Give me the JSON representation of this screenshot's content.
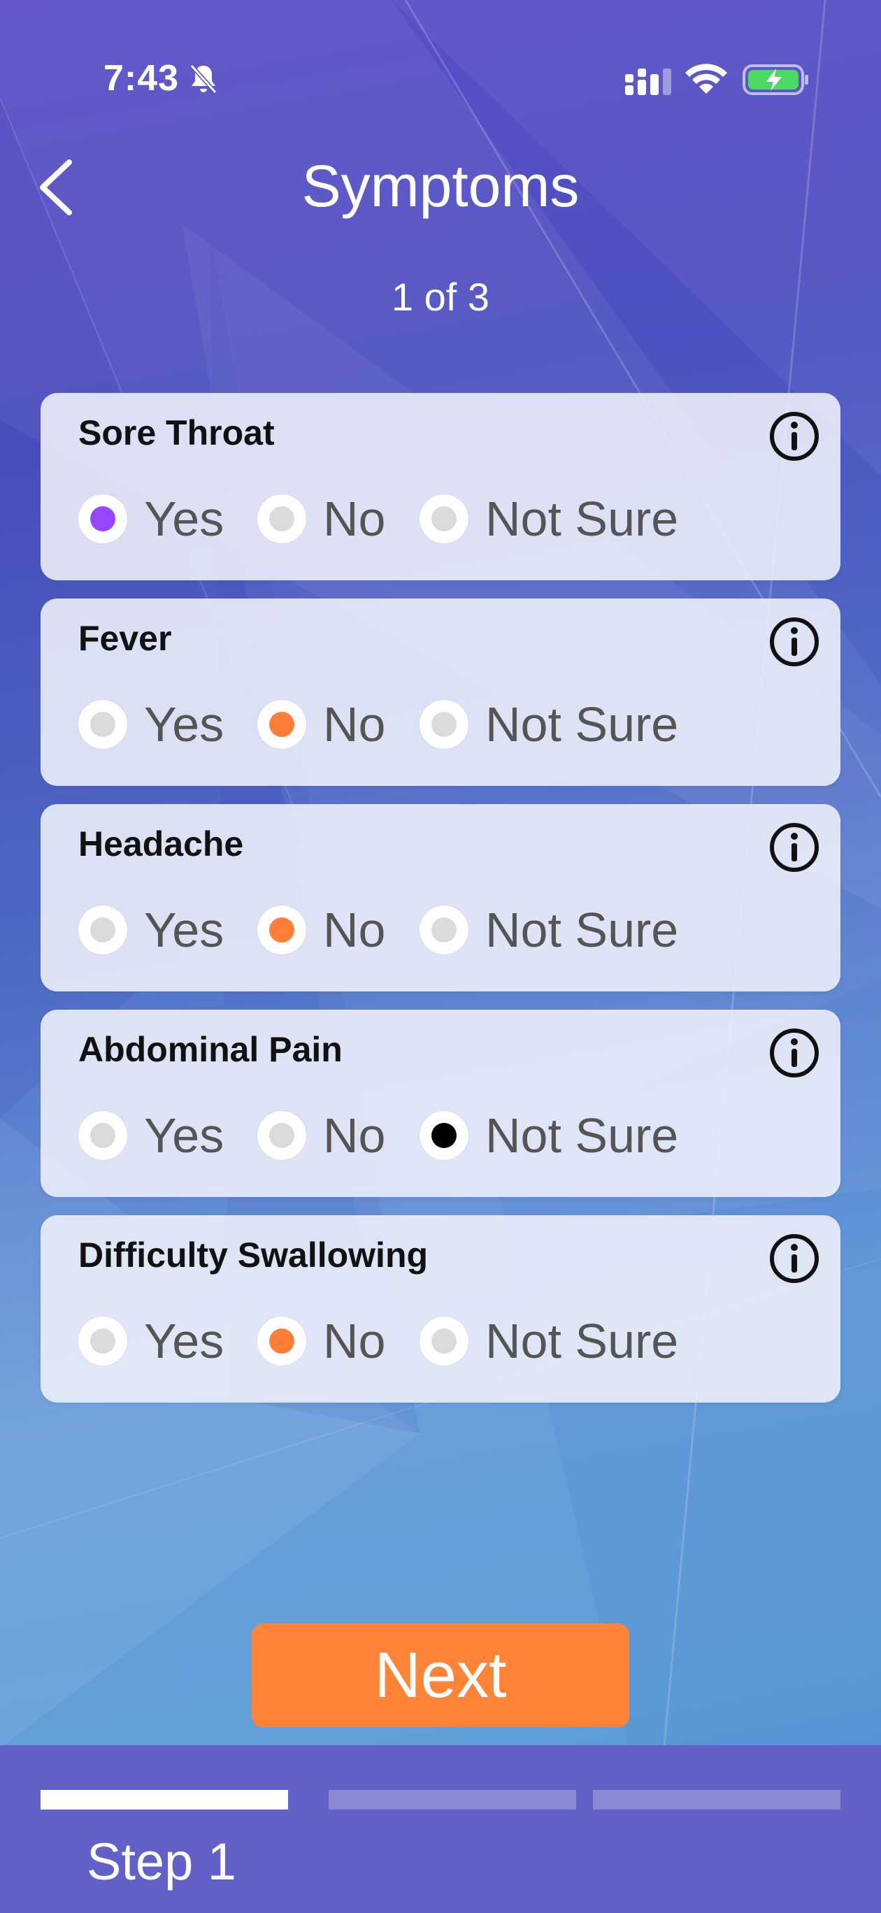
{
  "status_bar": {
    "time": "7:43",
    "icons": [
      "bell-slash-icon",
      "signal-icon",
      "wifi-icon",
      "battery-charging-icon"
    ]
  },
  "header": {
    "title": "Symptoms",
    "step_counter": "1 of 3",
    "back_icon": "chevron-left-icon"
  },
  "symptoms": [
    {
      "name": "Sore Throat",
      "options": [
        "Yes",
        "No",
        "Not Sure"
      ],
      "selected": "Yes",
      "selected_color": "#9747ff"
    },
    {
      "name": "Fever",
      "options": [
        "Yes",
        "No",
        "Not Sure"
      ],
      "selected": "No",
      "selected_color": "#ff7f3a"
    },
    {
      "name": "Headache",
      "options": [
        "Yes",
        "No",
        "Not Sure"
      ],
      "selected": "No",
      "selected_color": "#ff7f3a"
    },
    {
      "name": "Abdominal Pain",
      "options": [
        "Yes",
        "No",
        "Not Sure"
      ],
      "selected": "Not Sure",
      "selected_color": "#000000"
    },
    {
      "name": "Difficulty Swallowing",
      "options": [
        "Yes",
        "No",
        "Not Sure"
      ],
      "selected": "No",
      "selected_color": "#ff7f3a"
    }
  ],
  "next_button": {
    "label": "Next",
    "color": "#ff8437"
  },
  "footer": {
    "step_label": "Step 1",
    "progress": {
      "current": 1,
      "total": 3
    }
  },
  "colors": {
    "unselected_dot": "#dadbdd",
    "footer_bg": "#6261c7"
  }
}
